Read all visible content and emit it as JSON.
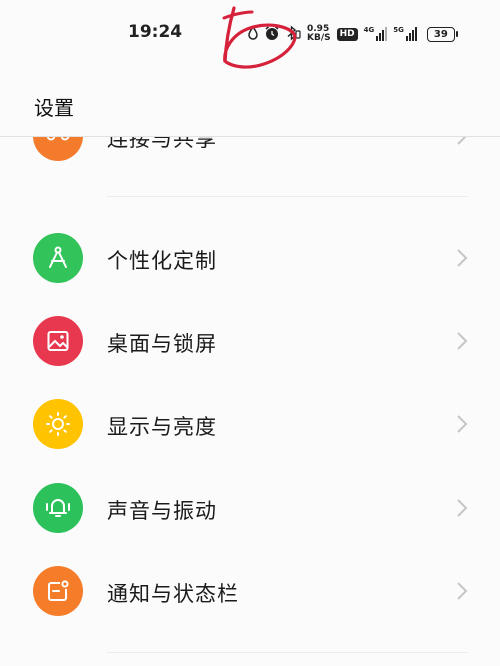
{
  "status_bar": {
    "time": "19:24",
    "net_speed_value": "0.95",
    "net_speed_unit": "KB/S",
    "hd_label": "HD",
    "sim1_label": "4G",
    "sim2_label": "5G",
    "battery_level": "39",
    "icons": [
      "drop-icon",
      "alarm-icon",
      "bluetooth-icon",
      "hd-icon",
      "signal-icon",
      "battery-icon"
    ]
  },
  "header": {
    "title": "设置"
  },
  "settings": {
    "items": [
      {
        "label": "连接与共享",
        "icon": "share-icon",
        "color": "#f47a2c"
      },
      {
        "label": "个性化定制",
        "icon": "compass-icon",
        "color": "#32c35a"
      },
      {
        "label": "桌面与锁屏",
        "icon": "wallpaper-icon",
        "color": "#e8384f"
      },
      {
        "label": "显示与亮度",
        "icon": "brightness-icon",
        "color": "#ffc300"
      },
      {
        "label": "声音与振动",
        "icon": "bell-icon",
        "color": "#2cc15a"
      },
      {
        "label": "通知与状态栏",
        "icon": "notification-icon",
        "color": "#f57d2a"
      }
    ]
  },
  "colors": {
    "background": "#fbfbfb",
    "annotation_red": "#d6213a",
    "chevron": "#c6c6c6"
  }
}
